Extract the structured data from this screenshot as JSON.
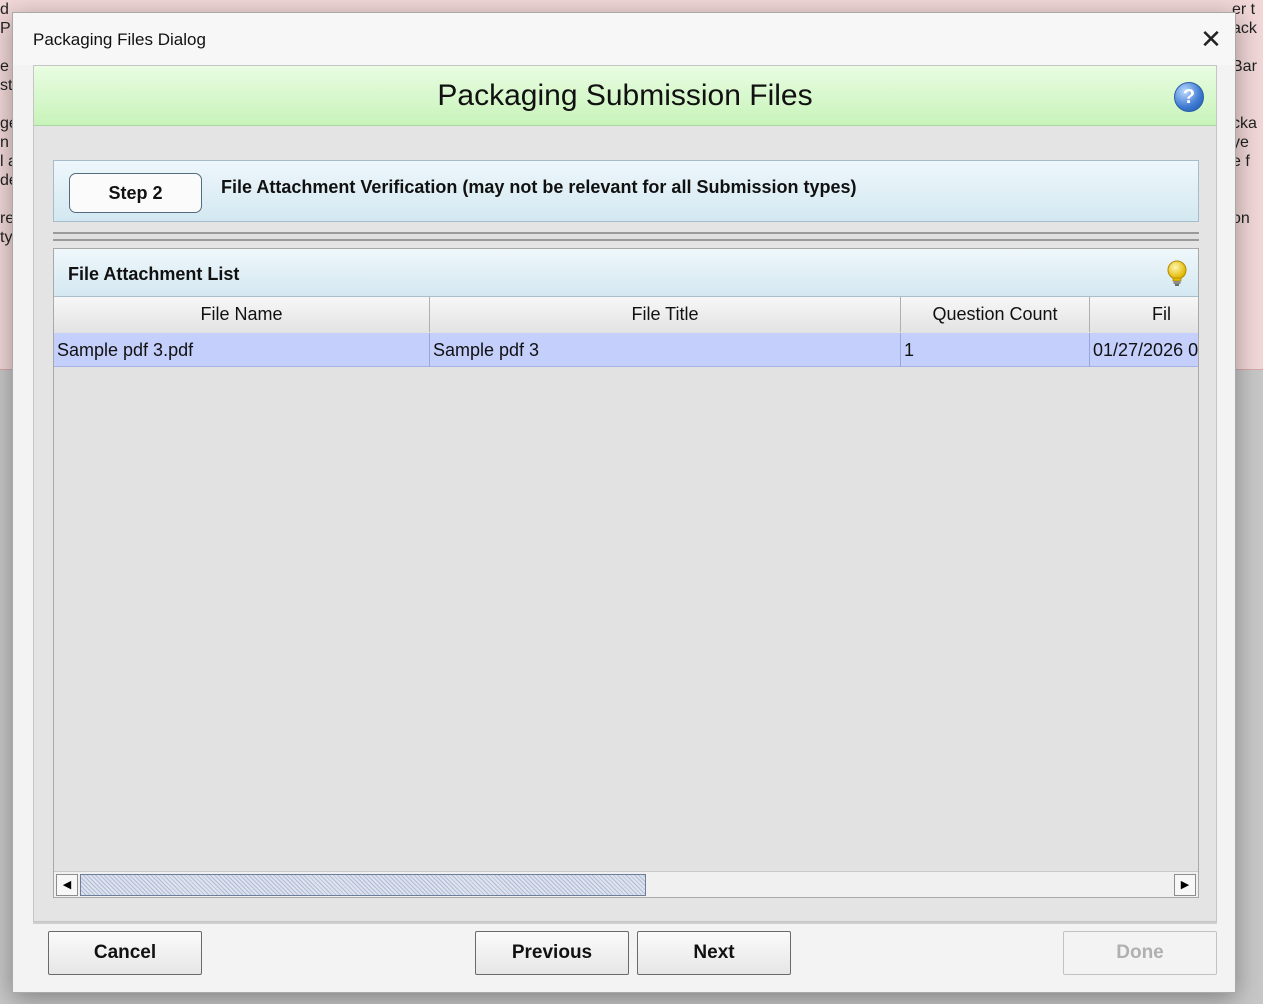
{
  "background": {
    "left_fragments": [
      "d",
      "P",
      "",
      "e a",
      "sti",
      "",
      "ge",
      "n fi",
      "l a",
      "de",
      "",
      "re",
      "typ"
    ],
    "right_fragments": [
      "er t",
      "ack",
      "",
      "Bar",
      "",
      "",
      "cka",
      "ye",
      "e f",
      "",
      "",
      "on",
      ""
    ]
  },
  "dialog": {
    "window_title": "Packaging Files Dialog",
    "close_glyph": "✕",
    "heading": "Packaging Submission Files",
    "help_glyph": "?",
    "step": {
      "label": "Step 2",
      "description": "File Attachment Verification (may not be relevant for all Submission types)"
    },
    "list": {
      "title": "File Attachment List",
      "columns": [
        "File Name",
        "File Title",
        "Question Count",
        "Fil"
      ],
      "rows": [
        [
          "Sample pdf 3.pdf",
          "Sample pdf 3",
          "1",
          "01/27/2026 0"
        ]
      ],
      "scroll_left_glyph": "◀",
      "scroll_right_glyph": "▶"
    },
    "buttons": {
      "cancel": "Cancel",
      "previous": "Previous",
      "next": "Next",
      "done": "Done"
    }
  },
  "colors": {
    "banner": "#c8f3ba",
    "selected_row": "#c5cffb",
    "help_icon": "#3b78d0",
    "bulb": "#f5d000"
  }
}
